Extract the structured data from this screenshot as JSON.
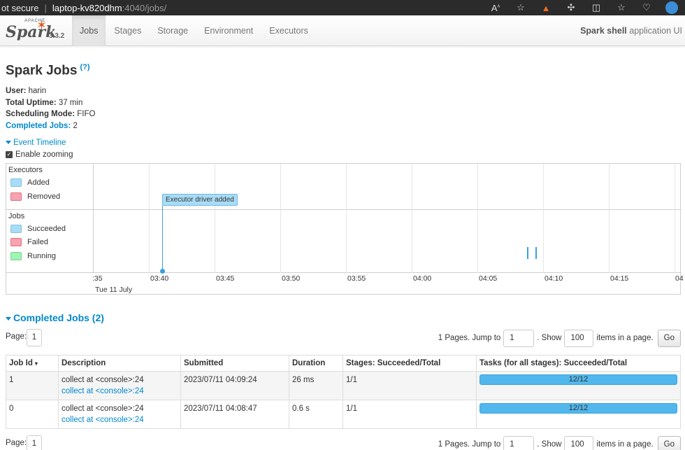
{
  "browser": {
    "security": "ot secure",
    "host": "laptop-kv820dhm",
    "path": ":4040/jobs/"
  },
  "navbar": {
    "logo_small": "APACHE",
    "logo_text": "Spark",
    "version": "3.3.2",
    "tabs": [
      {
        "label": "Jobs",
        "active": true
      },
      {
        "label": "Stages",
        "active": false
      },
      {
        "label": "Storage",
        "active": false
      },
      {
        "label": "Environment",
        "active": false
      },
      {
        "label": "Executors",
        "active": false
      }
    ],
    "app_name": "Spark shell",
    "app_suffix": " application UI"
  },
  "page": {
    "title": "Spark Jobs",
    "help": "(?)",
    "summary": {
      "user_label": "User:",
      "user_value": " harin",
      "uptime_label": "Total Uptime:",
      "uptime_value": " 37 min",
      "mode_label": "Scheduling Mode:",
      "mode_value": " FIFO",
      "completed_label": "Completed Jobs:",
      "completed_value": " 2"
    },
    "timeline_toggle": "Event Timeline",
    "zoom_label": "Enable zooming"
  },
  "timeline": {
    "executors_label": "Executors",
    "executors_legend": [
      {
        "label": "Added",
        "color": "#a9dcf6"
      },
      {
        "label": "Removed",
        "color": "#f8a3b0"
      }
    ],
    "jobs_label": "Jobs",
    "jobs_legend": [
      {
        "label": "Succeeded",
        "color": "#a9dcf6"
      },
      {
        "label": "Failed",
        "color": "#f8a3b0"
      },
      {
        "label": "Running",
        "color": "#a3f3b5"
      }
    ],
    "ticks": [
      ":35",
      "03:40",
      "03:45",
      "03:50",
      "03:55",
      "04:00",
      "04:05",
      "04:10",
      "04:15",
      "04"
    ],
    "date": "Tue 11 July",
    "event": "Executor driver added"
  },
  "completed": {
    "title": "Completed Jobs (2)",
    "page_label": "Page:",
    "page_number": "1",
    "pages_text": "1 Pages. Jump to",
    "jump_value": "1",
    "show_text": ". Show",
    "show_value": "100",
    "items_text": "items in a page.",
    "go": "Go",
    "columns": [
      "Job Id",
      "Description",
      "Submitted",
      "Duration",
      "Stages: Succeeded/Total",
      "Tasks (for all stages): Succeeded/Total"
    ],
    "sort_indicator": "▾",
    "rows": [
      {
        "id": "1",
        "desc": "collect at <console>:24",
        "desc_link": "collect at <console>:24",
        "submitted": "2023/07/11 04:09:24",
        "duration": "26 ms",
        "stages": "1/1",
        "tasks": "12/12",
        "tasks_fraction": 1.0
      },
      {
        "id": "0",
        "desc": "collect at <console>:24",
        "desc_link": "collect at <console>:24",
        "submitted": "2023/07/11 04:08:47",
        "duration": "0.6 s",
        "stages": "1/1",
        "tasks": "12/12",
        "tasks_fraction": 1.0
      }
    ]
  }
}
